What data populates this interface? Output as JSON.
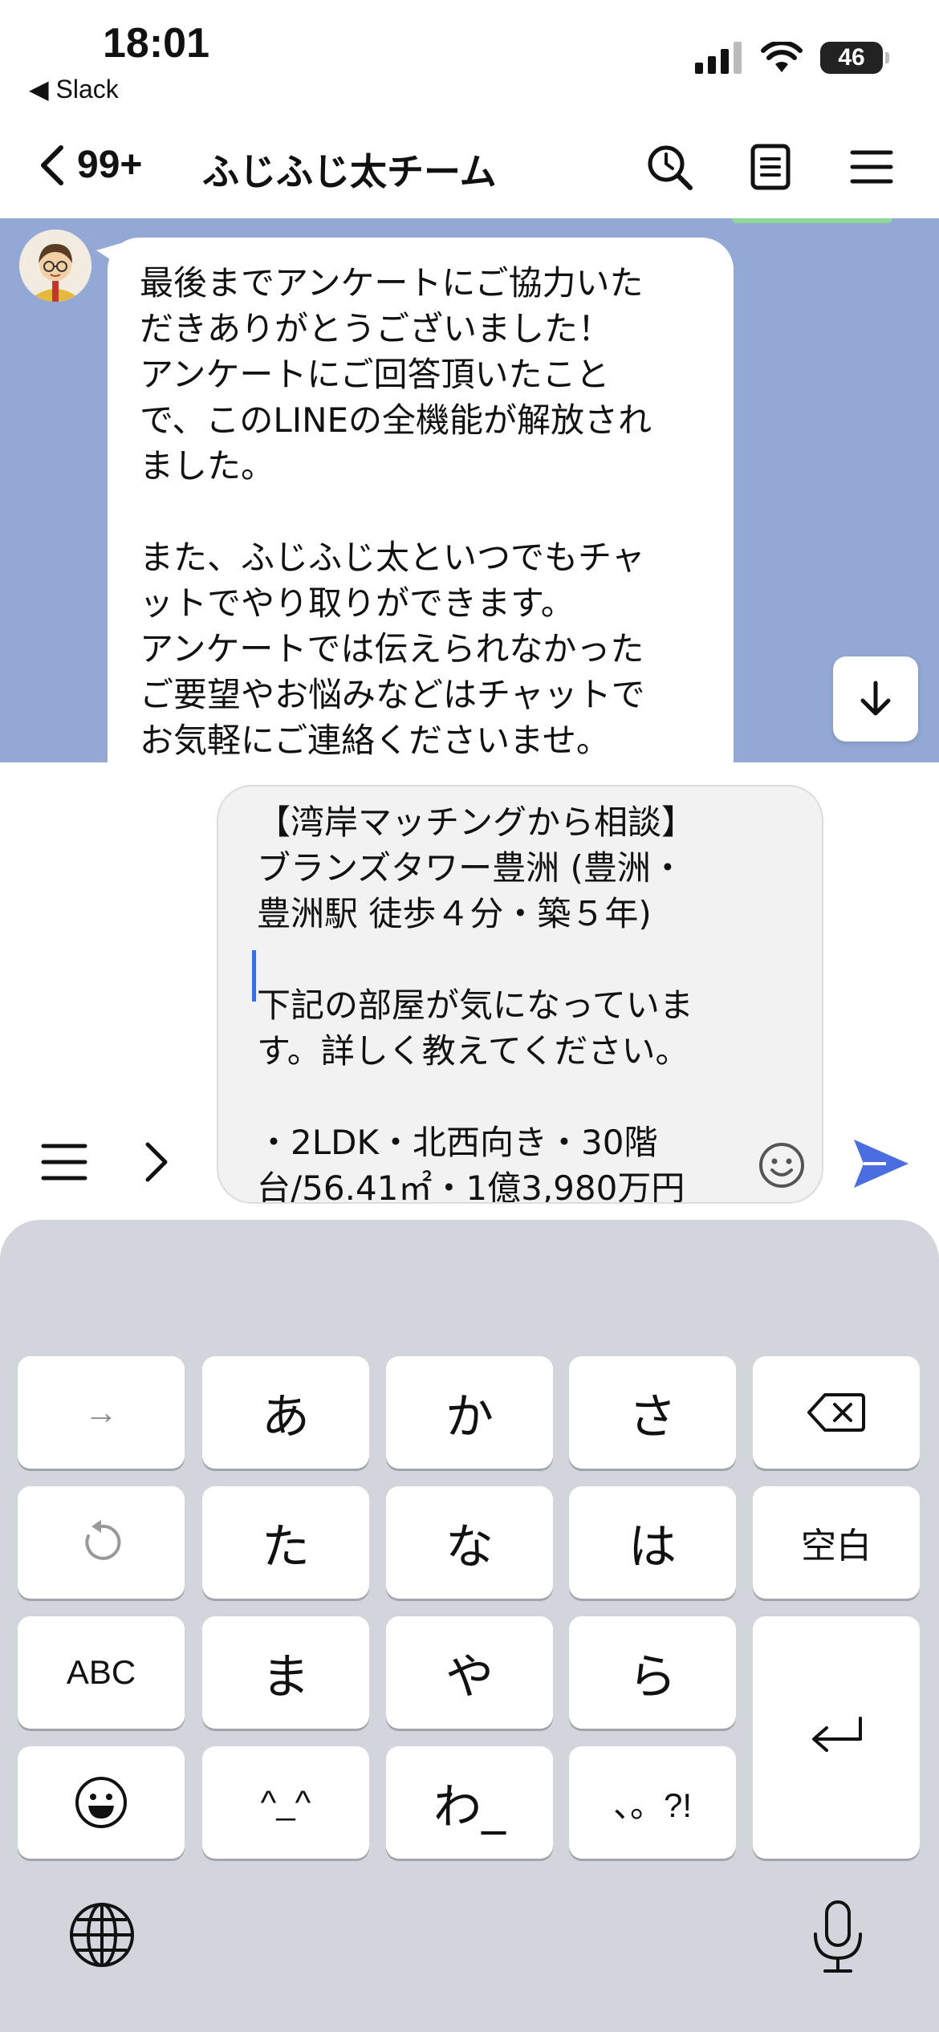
{
  "status_bar": {
    "time": "18:01",
    "back_app": "◀ Slack",
    "battery": "46",
    "icons": [
      "signal-icon",
      "wifi-icon",
      "battery-icon"
    ]
  },
  "header": {
    "unread_count": "99+",
    "title": "ふじふじ太チーム",
    "icons": [
      "back-chevron-icon",
      "search-icon",
      "notes-icon",
      "menu-icon"
    ]
  },
  "chat": {
    "message": {
      "sender_avatar": "avatar",
      "text": "最後までアンケートにご協力いた\nだきありがとうございました！\nアンケートにご回答頂いたこと\nで、このLINEの全機能が解放され\nました。\n\nまた、ふじふじ太といつでもチャ\nットでやり取りができます。\nアンケートでは伝えられなかった\nご要望やお悩みなどはチャットで\nお気軽にご連絡くださいませ。"
    },
    "scroll_down_icon": "arrow-down-icon"
  },
  "composer": {
    "text": "【湾岸マッチングから相談】\nブランズタワー豊洲 (豊洲・\n豊洲駅 徒歩４分・築５年)\n\n下記の部屋が気になっていま\nす。詳しく教えてください。\n\n・2LDK・北西向き・30階\n台/56.41㎡・1億3,980万円",
    "icons": [
      "menu-icon",
      "chevron-right-icon",
      "emoji-icon",
      "send-icon"
    ],
    "accent_color": "#4a6ee0"
  },
  "keyboard": {
    "keys": {
      "arrow": "→",
      "a": "あ",
      "ka": "か",
      "sa": "さ",
      "ta": "た",
      "na": "な",
      "ha": "は",
      "space": "空白",
      "abc": "ABC",
      "ma": "ま",
      "ya": "や",
      "ra": "ら",
      "kaomoji": "^_^",
      "wa": "わ_",
      "punct": "、。?!"
    },
    "icons": [
      "delete-icon",
      "undo-icon",
      "return-icon",
      "emoji-face-icon",
      "globe-icon",
      "mic-icon"
    ]
  }
}
